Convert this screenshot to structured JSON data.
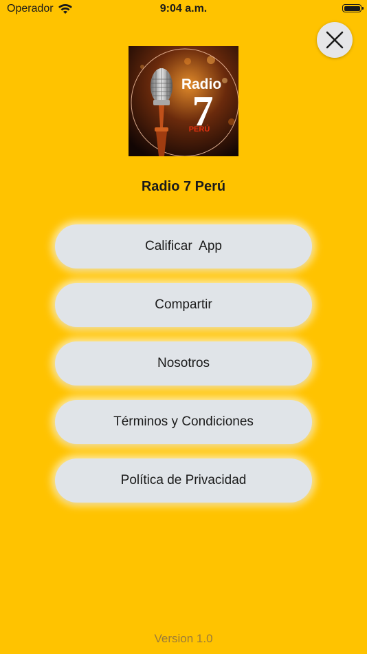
{
  "status_bar": {
    "carrier": "Operador",
    "time": "9:04 a.m."
  },
  "logo": {
    "line1": "Radio",
    "line2": "7",
    "line3": "PERÚ"
  },
  "app_name": "Radio 7 Perú",
  "menu": [
    {
      "label": "Calificar  App"
    },
    {
      "label": "Compartir"
    },
    {
      "label": "Nosotros"
    },
    {
      "label": "Términos y Condiciones"
    },
    {
      "label": "Política de Privacidad"
    }
  ],
  "version": "Version 1.0",
  "colors": {
    "background": "#FFC300",
    "button": "#E0E4E8",
    "close_button": "#E6E6E8",
    "version_text": "#9A7B3A"
  },
  "icons": {
    "close": "close-icon",
    "wifi": "wifi-icon",
    "battery": "battery-icon"
  }
}
